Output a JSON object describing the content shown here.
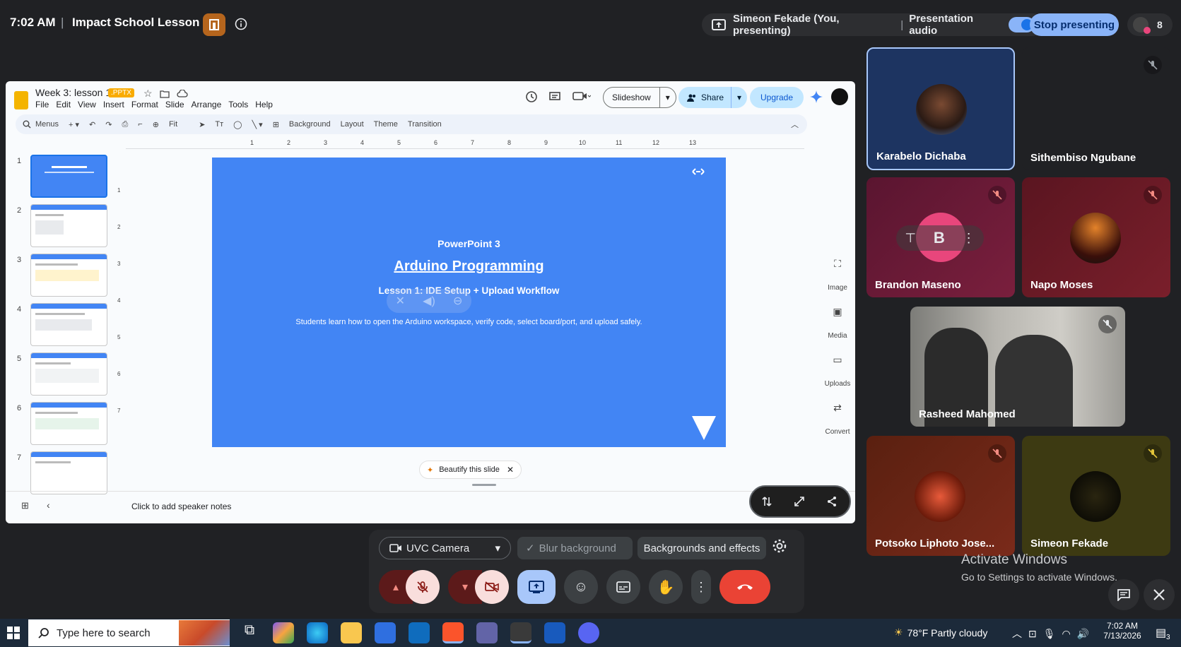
{
  "meet": {
    "time": "7:02 AM",
    "separator": "|",
    "meeting_title": "Impact School Lesson 7",
    "presenter_text": "Simeon Fekade (You, presenting)",
    "presentation_audio_label": "Presentation audio",
    "stop_presenting_label": "Stop presenting",
    "participant_count": "8"
  },
  "slides": {
    "doc_title": "Week 3: lesson 1",
    "file_badge": ".PPTX",
    "menus": [
      "File",
      "Edit",
      "View",
      "Insert",
      "Format",
      "Slide",
      "Arrange",
      "Tools",
      "Help"
    ],
    "slideshow_label": "Slideshow",
    "share_label": "Share",
    "upgrade_label": "Upgrade",
    "toolbar": {
      "menus_label": "Menus",
      "zoom_label": "Fit",
      "background_label": "Background",
      "layout_label": "Layout",
      "theme_label": "Theme",
      "transition_label": "Transition"
    },
    "ruler_ticks": [
      "1",
      "2",
      "3",
      "4",
      "5",
      "6",
      "7",
      "8",
      "9",
      "10",
      "11",
      "12",
      "13"
    ],
    "vertical_ruler_ticks": [
      "1",
      "2",
      "3",
      "4",
      "5",
      "6",
      "7"
    ],
    "thumbnail_numbers": [
      "1",
      "2",
      "3",
      "4",
      "5",
      "6",
      "7"
    ],
    "current_slide": {
      "kicker": "PowerPoint 3",
      "title": "Arduino Programming",
      "subtitle": "Lesson 1: IDE Setup + Upload Workflow",
      "description": "Students learn how to open the Arduino workspace, verify code, select board/port, and upload safely."
    },
    "side_tools": [
      "Image",
      "Media",
      "Uploads",
      "Convert"
    ],
    "beautify_label": "Beautify this slide",
    "speaker_notes_placeholder": "Click to add speaker notes"
  },
  "participants": [
    {
      "name": "Karabelo Dichaba",
      "bg": "#1d3461",
      "highlighted": true
    },
    {
      "name": "Sithembiso Ngubane",
      "bg": "#202124",
      "muted": true
    },
    {
      "name": "Brandon Maseno",
      "bg": "#7a1f3d",
      "muted": true,
      "initial": "B"
    },
    {
      "name": "Napo Moses",
      "bg": "#7a1f2b",
      "muted": true
    },
    {
      "name": "Rasheed Mahomed",
      "muted": true
    },
    {
      "name": "Potsoko Liphoto Jose...",
      "bg": "#7a2a1a",
      "muted": true
    },
    {
      "name": "Simeon Fekade",
      "bg": "#3d3a12",
      "muted": true
    }
  ],
  "controls": {
    "camera_label": "UVC Camera",
    "blur_label": "Blur background",
    "backgrounds_label": "Backgrounds and effects"
  },
  "watermark": {
    "line1": "Activate Windows",
    "line2": "Go to Settings to activate Windows."
  },
  "taskbar": {
    "search_placeholder": "Type here to search",
    "weather": "78°F  Partly cloudy",
    "clock_time": "7:02 AM",
    "clock_date": "7/13/2026",
    "notification_count": "3"
  },
  "colors": {
    "stop_presenting": "#8ab4f8",
    "end_call": "#ea4335",
    "slide_bg": "#4285f4",
    "share_btn": "#c2e7ff"
  }
}
